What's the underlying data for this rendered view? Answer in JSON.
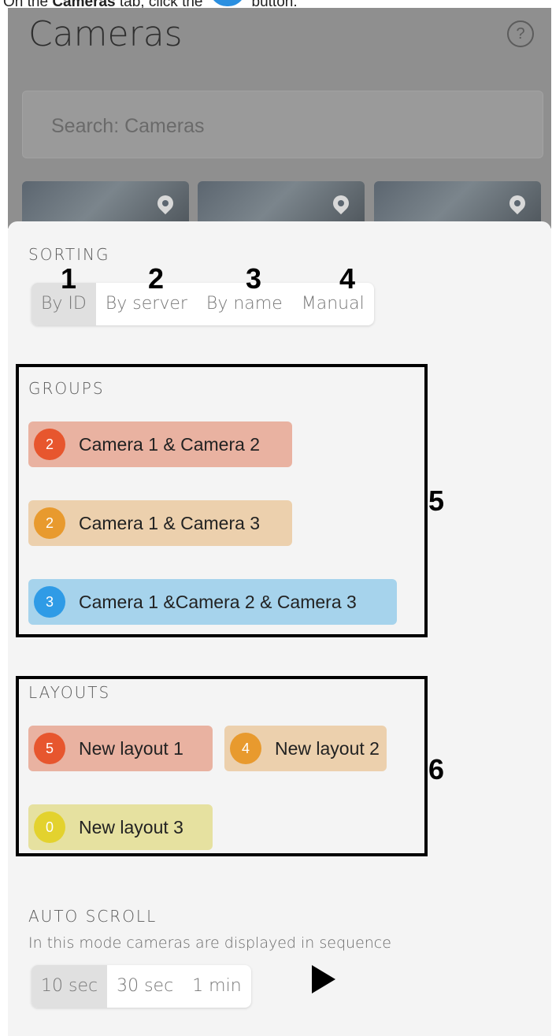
{
  "instruction": {
    "prefix": "On the",
    "tab_name": "Cameras",
    "middle": "tab, click the",
    "suffix": "button."
  },
  "background_screen": {
    "title": "Cameras",
    "help_icon": "question-circle-icon",
    "search_placeholder": "Search: Cameras"
  },
  "sorting": {
    "label": "SORTING",
    "options": [
      "By ID",
      "By server",
      "By name",
      "Manual"
    ],
    "selected": "By ID"
  },
  "groups": {
    "label": "GROUPS",
    "items": [
      {
        "count": "2",
        "label": "Camera 1 & Camera 2",
        "badge_color": "#e7562e",
        "chip_color": "#e9b2a1"
      },
      {
        "count": "2",
        "label": "Camera 1 & Camera 3",
        "badge_color": "#e89a2e",
        "chip_color": "#ecd0ad"
      },
      {
        "count": "3",
        "label": "Camera 1 &Camera 2 & Camera 3",
        "badge_color": "#2f9be6",
        "chip_color": "#a6d3ec"
      }
    ]
  },
  "layouts": {
    "label": "LAYOUTS",
    "items": [
      {
        "count": "5",
        "label": "New layout 1",
        "badge_color": "#e7562e",
        "chip_color": "#e9b2a1"
      },
      {
        "count": "4",
        "label": "New layout 2",
        "badge_color": "#e89a2e",
        "chip_color": "#ecd0ad"
      },
      {
        "count": "0",
        "label": "New layout 3",
        "badge_color": "#e3d22e",
        "chip_color": "#e6e1a0"
      }
    ]
  },
  "auto_scroll": {
    "label": "AUTO SCROLL",
    "description": "In this mode cameras are displayed in sequence",
    "options": [
      "10 sec",
      "30 sec",
      "1 min"
    ],
    "selected": "10 sec",
    "play_icon": "play-icon"
  },
  "callouts": [
    "1",
    "2",
    "3",
    "4",
    "5",
    "6"
  ]
}
